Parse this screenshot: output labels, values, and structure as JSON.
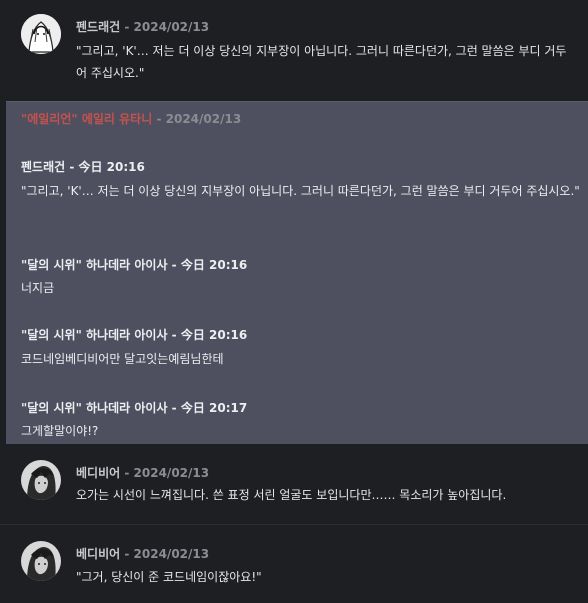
{
  "messages": [
    {
      "author": "펜드래건",
      "date": "2024/02/13",
      "text": "\"그리고, 'K'… 저는 더 이상 당신의 지부장이 아닙니다. 그러니 따른다던가, 그런 말씀은 부디 거두어 주십시오.\""
    },
    {
      "author": "베디비어",
      "date": "2024/02/13",
      "text": "오가는 시선이 느껴집니다. 쓴 표정 서린 얼굴도 보입니다만…… 목소리가 높아집니다."
    },
    {
      "author": "베디비어",
      "date": "2024/02/13",
      "text": "\"그거, 당신이 준 코드네임이잖아요!\""
    }
  ],
  "embed": {
    "title_author": "\"에일리언\" 에일리 유타니",
    "title_date": "2024/02/13",
    "entries": [
      {
        "header": "펜드래건 - 今日 20:16",
        "text": "\"그리고, 'K'… 저는 더 이상 당신의 지부장이 아닙니다. 그러니 따른다던가, 그런 말씀은 부디 거두어 주십시오.\""
      },
      {
        "header": "\"달의 시위\" 하나데라 아이사 - 今日 20:16",
        "text": "너지금"
      },
      {
        "header": "\"달의 시위\" 하나데라 아이사 - 今日 20:16",
        "text": "코드네임베디비어만 달고잇는예림님한테"
      },
      {
        "header": "\"달의 시위\" 하나데라 아이사 - 今日 20:17",
        "text": "그게할말이야!?"
      }
    ]
  },
  "colors": {
    "background": "#1e1f22",
    "embed": "#4f505f",
    "accent_red": "#c4524e"
  },
  "icons": [
    "pendragon-avatar",
    "bedivere-avatar"
  ]
}
